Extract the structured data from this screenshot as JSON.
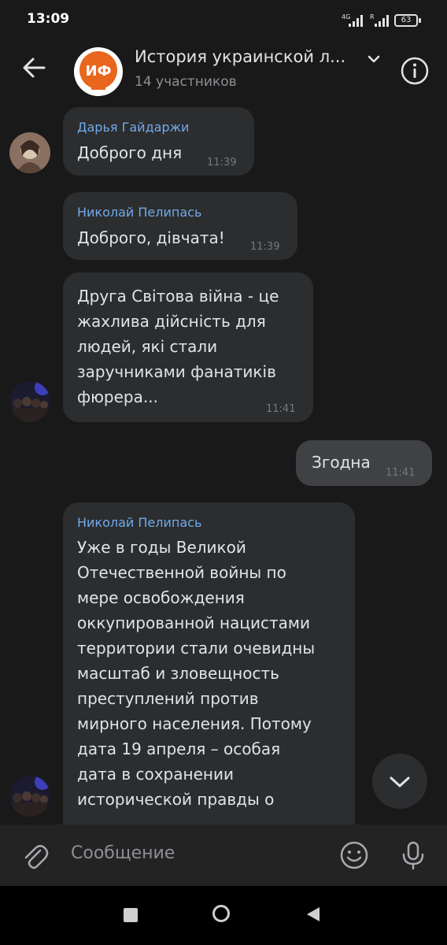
{
  "status": {
    "time": "13:09",
    "network": "4G",
    "signal_r": "R",
    "battery": "63"
  },
  "header": {
    "avatar_text": "ИФ",
    "title": "История украинской л...",
    "subtitle": "14 участников"
  },
  "messages": [
    {
      "sender": "Дарья Гайдаржи",
      "text": "Доброго дня",
      "time": "11:39",
      "direction": "in"
    },
    {
      "sender": "Николай Пелипась",
      "text": "Доброго, дівчата!",
      "time": "11:39",
      "direction": "in"
    },
    {
      "sender": "",
      "lines": [
        "Друга Світова війна - це",
        "жахлива дійсність для",
        "людей, які стали",
        "заручниками фанатиків",
        "фюрера..."
      ],
      "time": "11:41",
      "direction": "in"
    },
    {
      "sender": "",
      "text": "Згодна",
      "time": "11:41",
      "direction": "out"
    },
    {
      "sender": "Николай Пелипась",
      "lines": [
        "Уже в годы Великой",
        "Отечественной войны по",
        "мере освобождения",
        "оккупированной нацистами",
        "территории стали очевидны",
        "масштаб и зловещность",
        "преступлений против",
        "мирного населения. Потому",
        "дата 19 апреля – особая",
        "дата в сохранении",
        "исторической правды о"
      ],
      "time": "",
      "direction": "in"
    }
  ],
  "composer": {
    "placeholder": "Сообщение"
  },
  "colors": {
    "background": "#19191a",
    "bubble_in": "#2c2d2f",
    "bubble_out": "#404144",
    "sender_name": "#71aaeb",
    "avatar_brand": "#e8661e"
  },
  "icons": {
    "back": "arrow-left",
    "chevron": "chevron-down",
    "info": "info-circle",
    "scroll": "chevron-down",
    "attach": "paperclip",
    "emoji": "smiley",
    "mic": "microphone"
  }
}
